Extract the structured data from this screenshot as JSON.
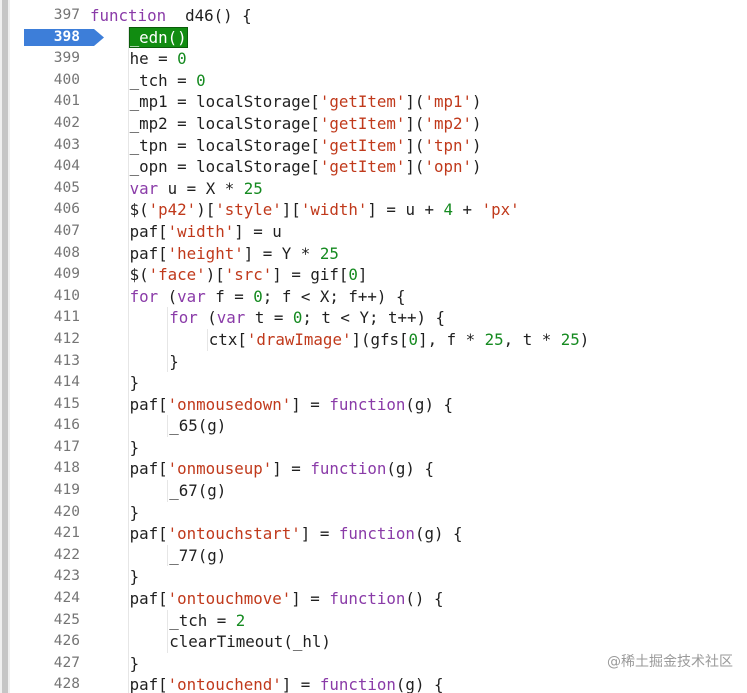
{
  "watermark": "@稀土掘金技术社区",
  "lines": [
    {
      "num": "397",
      "indent": 0,
      "tokens": [
        {
          "t": "function",
          "c": "kw"
        },
        {
          "t": "  d46() {"
        }
      ]
    },
    {
      "num": "398",
      "indent": 1,
      "current": true,
      "tokens": [
        {
          "t": "_edn()",
          "c": "paused-call"
        }
      ]
    },
    {
      "num": "399",
      "indent": 1,
      "tokens": [
        {
          "t": "he = "
        },
        {
          "t": "0",
          "c": "num"
        }
      ]
    },
    {
      "num": "400",
      "indent": 1,
      "tokens": [
        {
          "t": "_tch = "
        },
        {
          "t": "0",
          "c": "num"
        }
      ]
    },
    {
      "num": "401",
      "indent": 1,
      "tokens": [
        {
          "t": "_mp1 = localStorage["
        },
        {
          "t": "'getItem'",
          "c": "str"
        },
        {
          "t": "]("
        },
        {
          "t": "'mp1'",
          "c": "str"
        },
        {
          "t": ")"
        }
      ]
    },
    {
      "num": "402",
      "indent": 1,
      "tokens": [
        {
          "t": "_mp2 = localStorage["
        },
        {
          "t": "'getItem'",
          "c": "str"
        },
        {
          "t": "]("
        },
        {
          "t": "'mp2'",
          "c": "str"
        },
        {
          "t": ")"
        }
      ]
    },
    {
      "num": "403",
      "indent": 1,
      "tokens": [
        {
          "t": "_tpn = localStorage["
        },
        {
          "t": "'getItem'",
          "c": "str"
        },
        {
          "t": "]("
        },
        {
          "t": "'tpn'",
          "c": "str"
        },
        {
          "t": ")"
        }
      ]
    },
    {
      "num": "404",
      "indent": 1,
      "tokens": [
        {
          "t": "_opn = localStorage["
        },
        {
          "t": "'getItem'",
          "c": "str"
        },
        {
          "t": "]("
        },
        {
          "t": "'opn'",
          "c": "str"
        },
        {
          "t": ")"
        }
      ]
    },
    {
      "num": "405",
      "indent": 1,
      "tokens": [
        {
          "t": "var",
          "c": "kw"
        },
        {
          "t": " u = X * "
        },
        {
          "t": "25",
          "c": "num"
        }
      ]
    },
    {
      "num": "406",
      "indent": 1,
      "tokens": [
        {
          "t": "$("
        },
        {
          "t": "'p42'",
          "c": "str"
        },
        {
          "t": ")["
        },
        {
          "t": "'style'",
          "c": "str"
        },
        {
          "t": "]["
        },
        {
          "t": "'width'",
          "c": "str"
        },
        {
          "t": "] = u + "
        },
        {
          "t": "4",
          "c": "num"
        },
        {
          "t": " + "
        },
        {
          "t": "'px'",
          "c": "str"
        }
      ]
    },
    {
      "num": "407",
      "indent": 1,
      "tokens": [
        {
          "t": "paf["
        },
        {
          "t": "'width'",
          "c": "str"
        },
        {
          "t": "] = u"
        }
      ]
    },
    {
      "num": "408",
      "indent": 1,
      "tokens": [
        {
          "t": "paf["
        },
        {
          "t": "'height'",
          "c": "str"
        },
        {
          "t": "] = Y * "
        },
        {
          "t": "25",
          "c": "num"
        }
      ]
    },
    {
      "num": "409",
      "indent": 1,
      "tokens": [
        {
          "t": "$("
        },
        {
          "t": "'face'",
          "c": "str"
        },
        {
          "t": ")["
        },
        {
          "t": "'src'",
          "c": "str"
        },
        {
          "t": "] = gif["
        },
        {
          "t": "0",
          "c": "num"
        },
        {
          "t": "]"
        }
      ]
    },
    {
      "num": "410",
      "indent": 1,
      "tokens": [
        {
          "t": "for",
          "c": "kw"
        },
        {
          "t": " ("
        },
        {
          "t": "var",
          "c": "kw"
        },
        {
          "t": " f = "
        },
        {
          "t": "0",
          "c": "num"
        },
        {
          "t": "; f < X; f++) {"
        }
      ]
    },
    {
      "num": "411",
      "indent": 2,
      "tokens": [
        {
          "t": "for",
          "c": "kw"
        },
        {
          "t": " ("
        },
        {
          "t": "var",
          "c": "kw"
        },
        {
          "t": " t = "
        },
        {
          "t": "0",
          "c": "num"
        },
        {
          "t": "; t < Y; t++) {"
        }
      ]
    },
    {
      "num": "412",
      "indent": 3,
      "tokens": [
        {
          "t": "ctx["
        },
        {
          "t": "'drawImage'",
          "c": "str"
        },
        {
          "t": "](gfs["
        },
        {
          "t": "0",
          "c": "num"
        },
        {
          "t": "], f * "
        },
        {
          "t": "25",
          "c": "num"
        },
        {
          "t": ", t * "
        },
        {
          "t": "25",
          "c": "num"
        },
        {
          "t": ")"
        }
      ]
    },
    {
      "num": "413",
      "indent": 2,
      "tokens": [
        {
          "t": "}"
        }
      ]
    },
    {
      "num": "414",
      "indent": 1,
      "tokens": [
        {
          "t": "}"
        }
      ]
    },
    {
      "num": "415",
      "indent": 1,
      "tokens": [
        {
          "t": "paf["
        },
        {
          "t": "'onmousedown'",
          "c": "str"
        },
        {
          "t": "] = "
        },
        {
          "t": "function",
          "c": "kw"
        },
        {
          "t": "(g) {"
        }
      ]
    },
    {
      "num": "416",
      "indent": 2,
      "tokens": [
        {
          "t": "_65(g)"
        }
      ]
    },
    {
      "num": "417",
      "indent": 1,
      "tokens": [
        {
          "t": "}"
        }
      ]
    },
    {
      "num": "418",
      "indent": 1,
      "tokens": [
        {
          "t": "paf["
        },
        {
          "t": "'onmouseup'",
          "c": "str"
        },
        {
          "t": "] = "
        },
        {
          "t": "function",
          "c": "kw"
        },
        {
          "t": "(g) {"
        }
      ]
    },
    {
      "num": "419",
      "indent": 2,
      "tokens": [
        {
          "t": "_67(g)"
        }
      ]
    },
    {
      "num": "420",
      "indent": 1,
      "tokens": [
        {
          "t": "}"
        }
      ]
    },
    {
      "num": "421",
      "indent": 1,
      "tokens": [
        {
          "t": "paf["
        },
        {
          "t": "'ontouchstart'",
          "c": "str"
        },
        {
          "t": "] = "
        },
        {
          "t": "function",
          "c": "kw"
        },
        {
          "t": "(g) {"
        }
      ]
    },
    {
      "num": "422",
      "indent": 2,
      "tokens": [
        {
          "t": "_77(g)"
        }
      ]
    },
    {
      "num": "423",
      "indent": 1,
      "tokens": [
        {
          "t": "}"
        }
      ]
    },
    {
      "num": "424",
      "indent": 1,
      "tokens": [
        {
          "t": "paf["
        },
        {
          "t": "'ontouchmove'",
          "c": "str"
        },
        {
          "t": "] = "
        },
        {
          "t": "function",
          "c": "kw"
        },
        {
          "t": "() {"
        }
      ]
    },
    {
      "num": "425",
      "indent": 2,
      "tokens": [
        {
          "t": "_tch = "
        },
        {
          "t": "2",
          "c": "num"
        }
      ]
    },
    {
      "num": "426",
      "indent": 2,
      "tokens": [
        {
          "t": "clearTimeout(_hl)"
        }
      ]
    },
    {
      "num": "427",
      "indent": 1,
      "tokens": [
        {
          "t": "}"
        }
      ]
    },
    {
      "num": "428",
      "indent": 1,
      "tokens": [
        {
          "t": "paf["
        },
        {
          "t": "'ontouchend'",
          "c": "str"
        },
        {
          "t": "] = "
        },
        {
          "t": "function",
          "c": "kw"
        },
        {
          "t": "(g) {"
        }
      ]
    }
  ],
  "colors": {
    "keyword": "#8a3ba8",
    "string": "#c0391b",
    "number": "#158a20",
    "breakpoint": "#3d7ed9",
    "paused_highlight": "#118c11"
  }
}
